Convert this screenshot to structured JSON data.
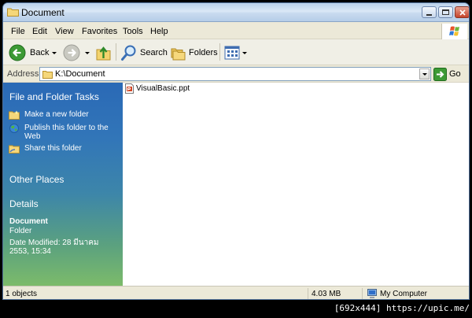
{
  "window": {
    "title": "Document",
    "folder_icon": "folder-icon"
  },
  "menu": [
    "File",
    "Edit",
    "View",
    "Favorites",
    "Tools",
    "Help"
  ],
  "toolbar": {
    "back_label": "Back",
    "search_label": "Search",
    "folders_label": "Folders"
  },
  "address": {
    "label": "Address",
    "value": "K:\\Document",
    "go_label": "Go"
  },
  "taskpane": {
    "folder_tasks_title": "File and Folder Tasks",
    "tasks": [
      {
        "label": "Make a new folder",
        "icon": "new-folder-icon"
      },
      {
        "label": "Publish this folder to the Web",
        "icon": "globe-icon"
      },
      {
        "label": "Share this folder",
        "icon": "share-folder-icon"
      }
    ],
    "other_places_title": "Other Places",
    "details_title": "Details",
    "details": {
      "name": "Document",
      "type": "Folder",
      "modified": "Date Modified: 28 มีนาคม 2553, 15:34"
    }
  },
  "files": [
    {
      "name": "VisualBasic.ppt",
      "icon": "powerpoint-file-icon"
    }
  ],
  "status": {
    "objects": "1 objects",
    "size": "4.03 MB",
    "zone": "My Computer"
  },
  "watermark": "[692x444] https://upic.me/",
  "colors": {
    "pane_top": "#2a69b6",
    "pane_bottom": "#7cbb6a",
    "titlebar": "#c9dbef"
  }
}
